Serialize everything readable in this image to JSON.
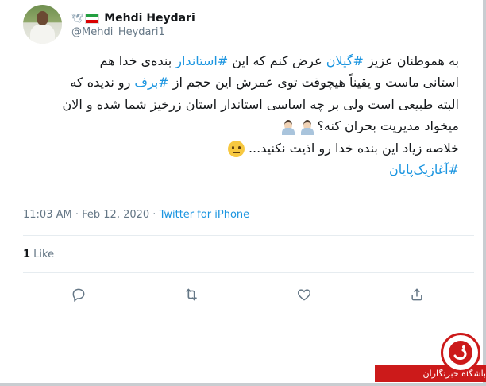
{
  "tweet": {
    "display_name": "Mehdi Heydari",
    "handle": "@Mehdi_Heydari1",
    "lines": [
      {
        "parts": [
          {
            "t": "به هموطنان عزیز ",
            "tag": false
          },
          {
            "t": "#گیلان",
            "tag": true
          },
          {
            "t": " عرض کنم که این ",
            "tag": false
          },
          {
            "t": "#استاندار",
            "tag": true
          },
          {
            "t": " بنده‌ی خدا هم",
            "tag": false
          }
        ]
      },
      {
        "parts": [
          {
            "t": "استانی ماست و یقیناً هیچوقت توی عمرش این حجم از ",
            "tag": false
          },
          {
            "t": "#برف",
            "tag": true
          },
          {
            "t": " رو ندیده که",
            "tag": false
          }
        ]
      },
      {
        "parts": [
          {
            "t": "البته طبیعی است ولی بر چه اساسی استاندار استان زرخیز شما شده و الان",
            "tag": false
          }
        ]
      },
      {
        "parts": [
          {
            "t": "میخواد مدیریت بحران کنه؟",
            "tag": false
          }
        ],
        "emoji": "person-facepalm"
      },
      {
        "parts": [
          {
            "t": "خلاصه زیاد این بنده خدا رو اذیت نکنید...",
            "tag": false
          }
        ],
        "emoji": "neutral-face"
      },
      {
        "parts": [
          {
            "t": "#آغازیک‌پایان",
            "tag": true
          }
        ]
      }
    ],
    "time": "11:03 AM",
    "sep": " · ",
    "date": "Feb 12, 2020",
    "source": "Twitter for iPhone",
    "like_count": "1",
    "like_label": " Like"
  },
  "icons": {
    "reply": "reply-icon",
    "retweet": "retweet-icon",
    "like": "heart-icon",
    "share": "share-icon"
  },
  "colors": {
    "link": "#1b95e0",
    "muted": "#657786",
    "watermark_red": "#cc1a1a"
  },
  "watermark": {
    "text": "باشگاه خبرنگاران"
  }
}
